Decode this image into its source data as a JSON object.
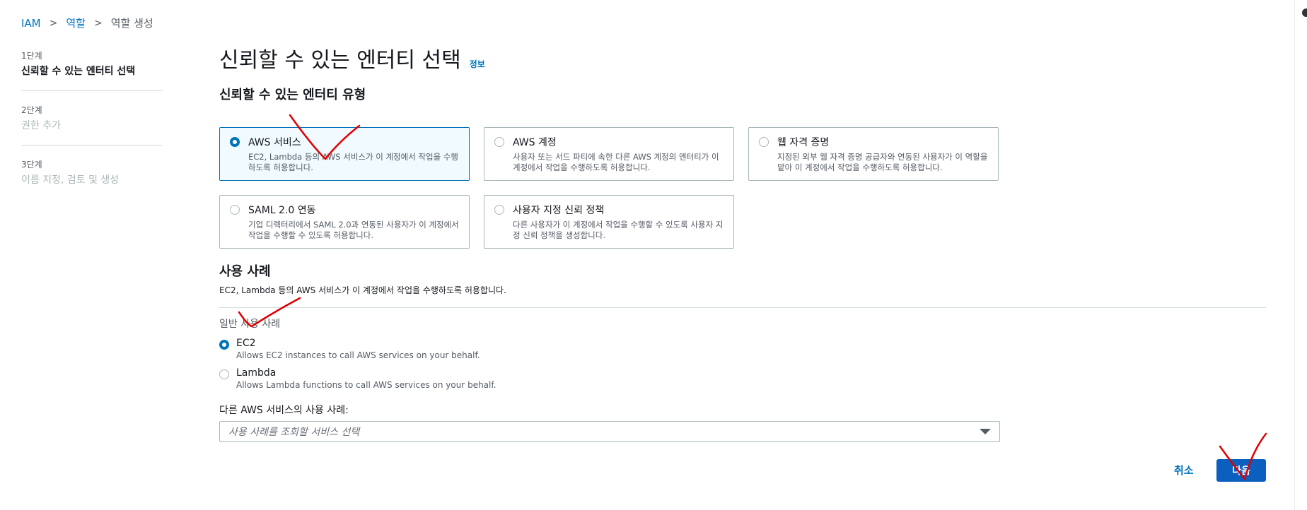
{
  "breadcrumb": {
    "items": [
      {
        "label": "IAM"
      },
      {
        "label": "역할"
      },
      {
        "label": "역할 생성"
      }
    ],
    "separator": ">"
  },
  "steps": [
    {
      "num": "1단계",
      "title": "신뢰할 수 있는 엔터티 선택",
      "state": "active"
    },
    {
      "num": "2단계",
      "title": "권한 추가",
      "state": "inactive"
    },
    {
      "num": "3단계",
      "title": "이름 지정, 검토 및 생성",
      "state": "inactive"
    }
  ],
  "page": {
    "title": "신뢰할 수 있는 엔터티 선택",
    "info_link": "정보",
    "entity_type_heading": "신뢰할 수 있는 엔터티 유형"
  },
  "entity_types": [
    {
      "title": "AWS 서비스",
      "desc": "EC2, Lambda 등의 AWS 서비스가 이 계정에서 작업을 수행하도록 허용합니다.",
      "selected": true
    },
    {
      "title": "AWS 계정",
      "desc": "사용자 또는 서드 파티에 속한 다른 AWS 계정의 엔터티가 이 계정에서 작업을 수행하도록 허용합니다.",
      "selected": false
    },
    {
      "title": "웹 자격 증명",
      "desc": "지정된 외부 웹 자격 증명 공급자와 연동된 사용자가 이 역할을 맡아 이 계정에서 작업을 수행하도록 허용합니다.",
      "selected": false
    },
    {
      "title": "SAML 2.0 연동",
      "desc": "기업 디렉터리에서 SAML 2.0과 연동된 사용자가 이 계정에서 작업을 수행할 수 있도록 허용합니다.",
      "selected": false
    },
    {
      "title": "사용자 지정 신뢰 정책",
      "desc": "다른 사용자가 이 계정에서 작업을 수행할 수 있도록 사용자 지정 신뢰 정책을 생성합니다.",
      "selected": false
    }
  ],
  "use_case": {
    "heading": "사용 사례",
    "subtitle": "EC2, Lambda 등의 AWS 서비스가 이 계정에서 작업을 수행하도록 허용합니다.",
    "common_label": "일반 사용 사례",
    "options": [
      {
        "title": "EC2",
        "desc": "Allows EC2 instances to call AWS services on your behalf.",
        "selected": true
      },
      {
        "title": "Lambda",
        "desc": "Allows Lambda functions to call AWS services on your behalf.",
        "selected": false
      }
    ],
    "other_label": "다른 AWS 서비스의 사용 사례:",
    "select_placeholder": "사용 사례를 조회할 서비스 선택"
  },
  "footer": {
    "cancel_label": "취소",
    "next_label": "다음"
  },
  "colors": {
    "accent": "#0073bb",
    "primary_button": "#0a5fbf",
    "annotation": "#e00000"
  }
}
